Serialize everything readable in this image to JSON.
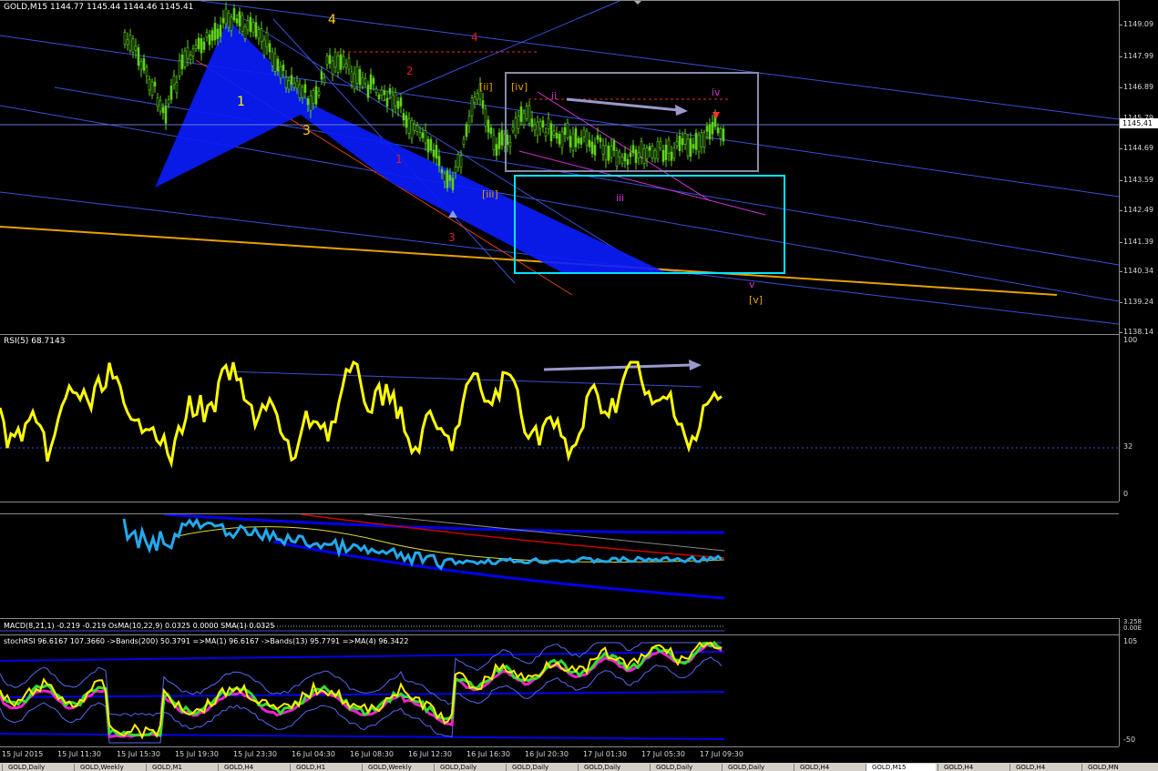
{
  "main": {
    "header": "GOLD,M15  1144.77 1145.44 1144.46 1145.41",
    "current_price": "1145.41",
    "price_scale": [
      "1149.09",
      "1147.99",
      "1146.89",
      "1145.79",
      "1144.69",
      "1143.59",
      "1142.49",
      "1141.39",
      "1140.34",
      "1139.24",
      "1138.14"
    ],
    "wave_labels_yellow": [
      "1",
      "3",
      "4"
    ],
    "wave_labels_red": [
      "1",
      "2",
      "3",
      "4"
    ],
    "wave_labels_orange": [
      "[ii]",
      "[iii]",
      "[iv]",
      "[v]"
    ],
    "wave_labels_purple": [
      "ii",
      "iii",
      "iv",
      "v"
    ]
  },
  "rsi": {
    "header": "RSI(5) 68.7143",
    "scale": [
      "100",
      "32",
      "0"
    ]
  },
  "macd": {
    "header": "MACD(8,21,1) -0.219 -0.219  OsMA(10,22,9) 0.0325 0.0000  SMA(1) 0.0325",
    "scale": [
      "3.258",
      "0.00E"
    ]
  },
  "stoch": {
    "header": "stochRSI 96.6167 107.3660  ->Bands(200) 50.3791  =>MA(1) 96.6167  ->Bands(13) 95.7791  =>MA(4) 96.3422",
    "scale": [
      "105",
      "-50"
    ]
  },
  "time_axis": [
    "15 Jul 2015",
    "15 Jul 11:30",
    "15 Jul 15:30",
    "15 Jul 19:30",
    "15 Jul 23:30",
    "16 Jul 04:30",
    "16 Jul 08:30",
    "16 Jul 12:30",
    "16 Jul 16:30",
    "16 Jul 20:30",
    "17 Jul 01:30",
    "17 Jul 05:30",
    "17 Jul 09:30"
  ],
  "tabs": [
    "GOLD,Daily",
    "GOLD,Weekly",
    "GOLD,M1",
    "GOLD,H4",
    "GOLD,H1",
    "GOLD,Weekly",
    "GOLD,Daily",
    "GOLD,Daily",
    "GOLD,Daily",
    "GOLD,Daily",
    "GOLD,Daily",
    "GOLD,H4",
    "GOLD,M15",
    "GOLD,H4",
    "GOLD,H4",
    "GOLD,MN"
  ],
  "colors": {
    "candles": "#5fd21a",
    "wedge": "#0a1cff",
    "rsi": "#ffff00",
    "stoch_cyan": "#22aaee",
    "box_cyan": "#00e5ff",
    "box_gray": "#8888aa",
    "trendline": "#3a4fd8",
    "orange_line": "#e8a000"
  }
}
